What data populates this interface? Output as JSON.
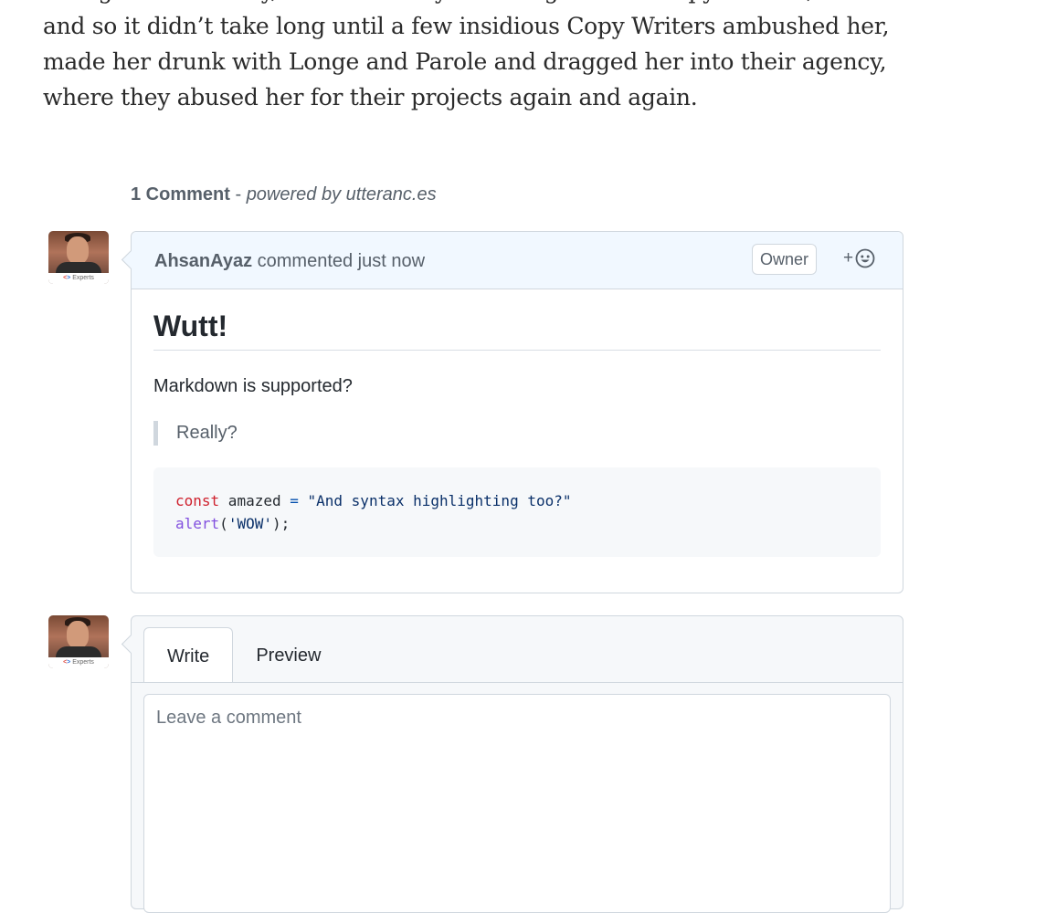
{
  "article": {
    "lines": [
      "a long and hard way, she was always on the guard for Copy Writers,",
      "and so it didn’t take long until a few insidious Copy Writers ambushed her,",
      "made her drunk with Longe and Parole and dragged her into their agency,",
      "where they abused her for their projects again and again."
    ]
  },
  "comments_meta": {
    "count_label": "1 Comment",
    "separator": " - ",
    "powered_by": "powered by utteranc.es"
  },
  "avatar": {
    "badge_text": "Experts",
    "brackets_left": "<",
    "brackets_right": ">"
  },
  "comment": {
    "author": "AhsanAyaz",
    "action": " commented just now",
    "owner_badge": "Owner",
    "reaction_plus": "+",
    "body": {
      "heading": "Wutt!",
      "paragraph": "Markdown is supported?",
      "quote": "Really?",
      "code": {
        "line1": {
          "keyword": "const",
          "var": " amazed ",
          "op": "=",
          "string": " \"And syntax highlighting too?\""
        },
        "line2": {
          "func": "alert",
          "rest_open": "(",
          "string": "'WOW'",
          "rest_close": ");"
        }
      }
    }
  },
  "editor": {
    "tabs": [
      "Write",
      "Preview"
    ],
    "placeholder": "Leave a comment"
  }
}
